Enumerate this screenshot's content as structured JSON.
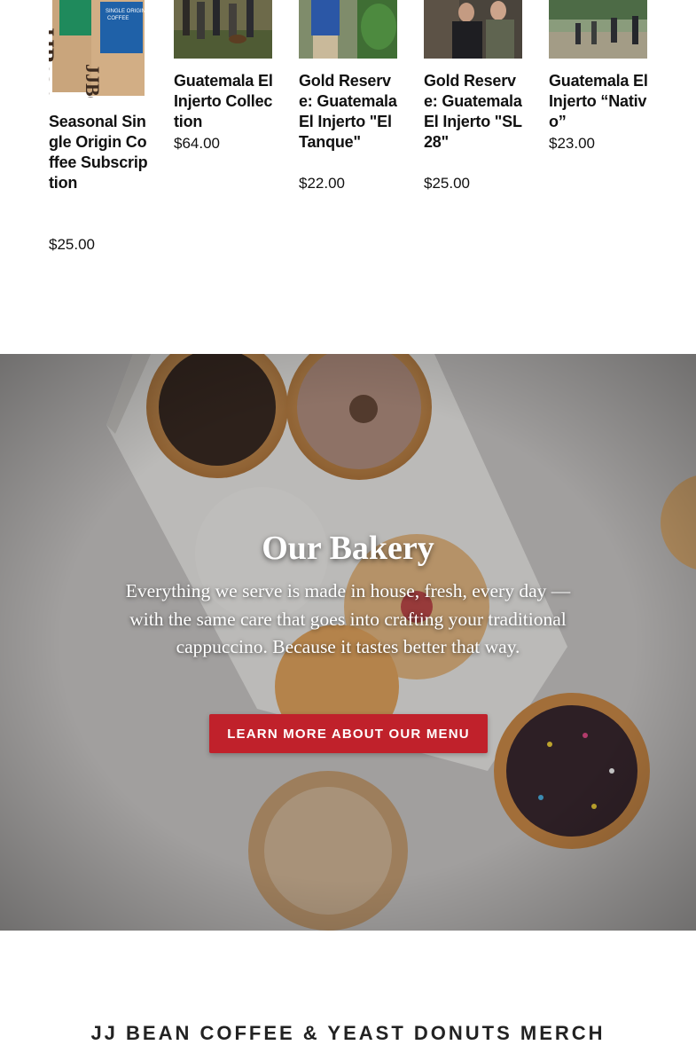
{
  "products": [
    {
      "name": "Seasonal Single Origin Coffee Subscription",
      "price": "$25.00",
      "image": "coffee-bags-image"
    },
    {
      "name": "Guatemala El Injerto Collection",
      "price": "$64.00",
      "image": "farm-group-photo"
    },
    {
      "name": "Gold Reserve: Guatemala El Injerto \"El Tanque\"",
      "price": "$22.00",
      "image": "farmer-portrait-photo"
    },
    {
      "name": "Gold Reserve: Guatemala El Injerto \"SL28\"",
      "price": "$25.00",
      "image": "two-men-photo"
    },
    {
      "name": "Guatemala El Injerto “Nativo”",
      "price": "$23.00",
      "image": "farm-walk-photo"
    }
  ],
  "coffee_bag_labels": {
    "brand": "JJBean",
    "bag_text": "SINGLE ORIGIN COFFEE"
  },
  "bakery": {
    "title": "Our Bakery",
    "text": "Everything we serve is made in house, fresh, every day — with the same care that goes into crafting your traditional cappuccino. Because it tastes better that way.",
    "button_label": "LEARN MORE ABOUT OUR MENU",
    "button_color": "#c0212b"
  },
  "next_section": {
    "heading": "JJ BEAN COFFEE & YEAST DONUTS MERCH"
  }
}
